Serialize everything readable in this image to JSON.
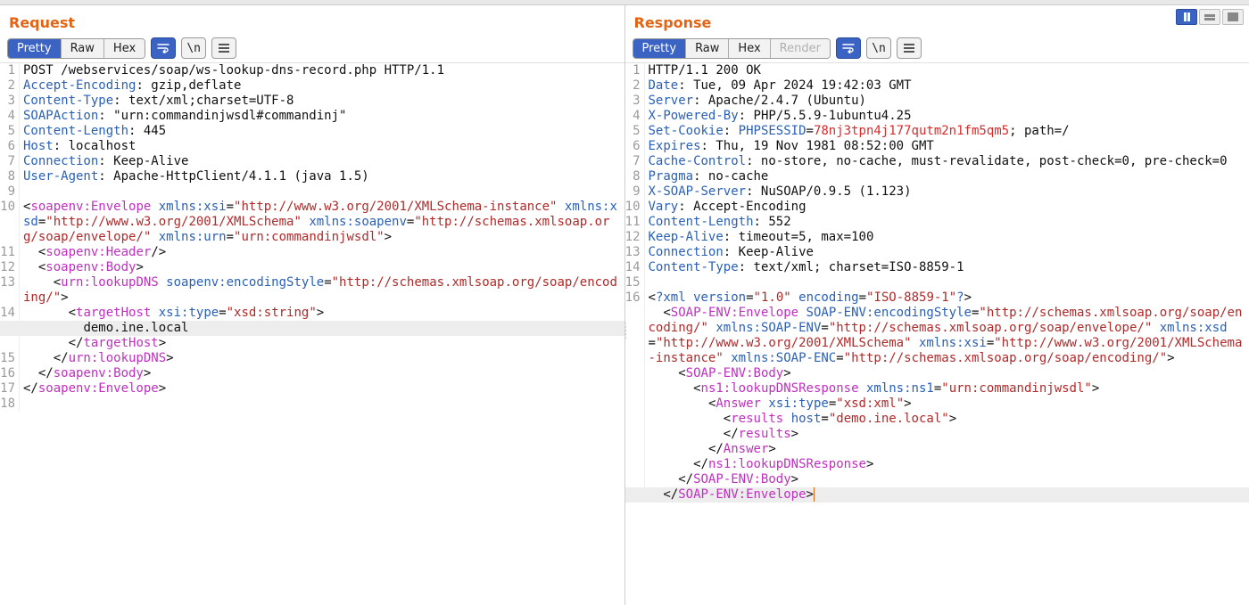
{
  "layout_buttons": [
    "split-vertical",
    "rows",
    "single"
  ],
  "layout_active": 0,
  "request": {
    "title": "Request",
    "tabs": [
      "Pretty",
      "Raw",
      "Hex"
    ],
    "activeTab": 0,
    "icons": [
      "wrap-icon",
      "newline-icon",
      "menu-icon"
    ],
    "lines": [
      {
        "n": 1,
        "raw": [
          [
            "txt",
            "POST /webservices/soap/ws-lookup-dns-record.php HTTP/1.1"
          ]
        ]
      },
      {
        "n": 2,
        "raw": [
          [
            "hdr",
            "Accept-Encoding"
          ],
          [
            "txt",
            ": gzip,deflate"
          ]
        ]
      },
      {
        "n": 3,
        "raw": [
          [
            "hdr",
            "Content-Type"
          ],
          [
            "txt",
            ": text/xml;charset=UTF-8"
          ]
        ]
      },
      {
        "n": 4,
        "raw": [
          [
            "hdr",
            "SOAPAction"
          ],
          [
            "txt",
            ": \"urn:commandinjwsdl#commandinj\""
          ]
        ]
      },
      {
        "n": 5,
        "raw": [
          [
            "hdr",
            "Content-Length"
          ],
          [
            "txt",
            ": 445"
          ]
        ]
      },
      {
        "n": 6,
        "raw": [
          [
            "hdr",
            "Host"
          ],
          [
            "txt",
            ": localhost"
          ]
        ]
      },
      {
        "n": 7,
        "raw": [
          [
            "hdr",
            "Connection"
          ],
          [
            "txt",
            ": Keep-Alive"
          ]
        ]
      },
      {
        "n": 8,
        "raw": [
          [
            "hdr",
            "User-Agent"
          ],
          [
            "txt",
            ": Apache-HttpClient/4.1.1 (java 1.5)"
          ]
        ]
      },
      {
        "n": 9,
        "raw": [
          [
            "txt",
            ""
          ]
        ]
      },
      {
        "n": 10,
        "raw": [
          [
            "txt",
            "<"
          ],
          [
            "tag",
            "soapenv:Envelope"
          ],
          [
            "txt",
            " "
          ],
          [
            "attr",
            "xmlns:xsi"
          ],
          [
            "txt",
            "="
          ],
          [
            "str",
            "\"http://www.w3.org/2001/XMLSchema-instance\""
          ],
          [
            "txt",
            " "
          ],
          [
            "attr",
            "xmlns:xsd"
          ],
          [
            "txt",
            "="
          ],
          [
            "str",
            "\"http://www.w3.org/2001/XMLSchema\""
          ],
          [
            "txt",
            " "
          ],
          [
            "attr",
            "xmlns:soapenv"
          ],
          [
            "txt",
            "="
          ],
          [
            "str",
            "\"http://schemas.xmlsoap.org/soap/envelope/\""
          ],
          [
            "txt",
            " "
          ],
          [
            "attr",
            "xmlns:urn"
          ],
          [
            "txt",
            "="
          ],
          [
            "str",
            "\"urn:commandinjwsdl\""
          ],
          [
            "txt",
            ">"
          ]
        ]
      },
      {
        "n": 11,
        "raw": [
          [
            "txt",
            "  <"
          ],
          [
            "tag",
            "soapenv:Header"
          ],
          [
            "txt",
            "/>"
          ]
        ]
      },
      {
        "n": 12,
        "raw": [
          [
            "txt",
            "  <"
          ],
          [
            "tag",
            "soapenv:Body"
          ],
          [
            "txt",
            ">"
          ]
        ]
      },
      {
        "n": 13,
        "raw": [
          [
            "txt",
            "    <"
          ],
          [
            "tag",
            "urn:lookupDNS"
          ],
          [
            "txt",
            " "
          ],
          [
            "attr",
            "soapenv:encodingStyle"
          ],
          [
            "txt",
            "="
          ],
          [
            "str",
            "\"http://schemas.xmlsoap.org/soap/encoding/\""
          ],
          [
            "txt",
            ">"
          ]
        ]
      },
      {
        "n": 14,
        "raw": [
          [
            "txt",
            "      <"
          ],
          [
            "tag",
            "targetHost"
          ],
          [
            "txt",
            " "
          ],
          [
            "attr",
            "xsi:type"
          ],
          [
            "txt",
            "="
          ],
          [
            "str",
            "\"xsd:string\""
          ],
          [
            "txt",
            ">"
          ]
        ]
      },
      {
        "n": "",
        "hl": true,
        "raw": [
          [
            "txt",
            "        demo.ine.local"
          ]
        ]
      },
      {
        "n": "",
        "raw": [
          [
            "txt",
            "      </"
          ],
          [
            "tag",
            "targetHost"
          ],
          [
            "txt",
            ">"
          ]
        ]
      },
      {
        "n": 15,
        "raw": [
          [
            "txt",
            "    </"
          ],
          [
            "tag",
            "urn:lookupDNS"
          ],
          [
            "txt",
            ">"
          ]
        ]
      },
      {
        "n": 16,
        "raw": [
          [
            "txt",
            "  </"
          ],
          [
            "tag",
            "soapenv:Body"
          ],
          [
            "txt",
            ">"
          ]
        ]
      },
      {
        "n": 17,
        "raw": [
          [
            "txt",
            "</"
          ],
          [
            "tag",
            "soapenv:Envelope"
          ],
          [
            "txt",
            ">"
          ]
        ]
      },
      {
        "n": 18,
        "raw": [
          [
            "txt",
            ""
          ]
        ]
      }
    ]
  },
  "response": {
    "title": "Response",
    "tabs": [
      "Pretty",
      "Raw",
      "Hex",
      "Render"
    ],
    "activeTab": 0,
    "disabledTabs": [
      3
    ],
    "icons": [
      "wrap-icon",
      "newline-icon",
      "menu-icon"
    ],
    "lines": [
      {
        "n": 1,
        "raw": [
          [
            "txt",
            "HTTP/1.1 200 OK"
          ]
        ]
      },
      {
        "n": 2,
        "raw": [
          [
            "hdr",
            "Date"
          ],
          [
            "txt",
            ": Tue, 09 Apr 2024 19:42:03 GMT"
          ]
        ]
      },
      {
        "n": 3,
        "raw": [
          [
            "hdr",
            "Server"
          ],
          [
            "txt",
            ": Apache/2.4.7 (Ubuntu)"
          ]
        ]
      },
      {
        "n": 4,
        "raw": [
          [
            "hdr",
            "X-Powered-By"
          ],
          [
            "txt",
            ": PHP/5.5.9-1ubuntu4.25"
          ]
        ]
      },
      {
        "n": 5,
        "raw": [
          [
            "hdr",
            "Set-Cookie"
          ],
          [
            "txt",
            ": "
          ],
          [
            "hdr",
            "PHPSESSID"
          ],
          [
            "txt",
            "="
          ],
          [
            "red",
            "78nj3tpn4j177qutm2n1fm5qm5"
          ],
          [
            "txt",
            "; path=/"
          ]
        ]
      },
      {
        "n": 6,
        "raw": [
          [
            "hdr",
            "Expires"
          ],
          [
            "txt",
            ": Thu, 19 Nov 1981 08:52:00 GMT"
          ]
        ]
      },
      {
        "n": 7,
        "raw": [
          [
            "hdr",
            "Cache-Control"
          ],
          [
            "txt",
            ": no-store, no-cache, must-revalidate, post-check=0, pre-check=0"
          ]
        ]
      },
      {
        "n": 8,
        "raw": [
          [
            "hdr",
            "Pragma"
          ],
          [
            "txt",
            ": no-cache"
          ]
        ]
      },
      {
        "n": 9,
        "raw": [
          [
            "hdr",
            "X-SOAP-Server"
          ],
          [
            "txt",
            ": NuSOAP/0.9.5 (1.123)"
          ]
        ]
      },
      {
        "n": 10,
        "raw": [
          [
            "hdr",
            "Vary"
          ],
          [
            "txt",
            ": Accept-Encoding"
          ]
        ]
      },
      {
        "n": 11,
        "raw": [
          [
            "hdr",
            "Content-Length"
          ],
          [
            "txt",
            ": 552"
          ]
        ]
      },
      {
        "n": 12,
        "raw": [
          [
            "hdr",
            "Keep-Alive"
          ],
          [
            "txt",
            ": timeout=5, max=100"
          ]
        ]
      },
      {
        "n": 13,
        "raw": [
          [
            "hdr",
            "Connection"
          ],
          [
            "txt",
            ": Keep-Alive"
          ]
        ]
      },
      {
        "n": 14,
        "raw": [
          [
            "hdr",
            "Content-Type"
          ],
          [
            "txt",
            ": text/xml; charset=ISO-8859-1"
          ]
        ]
      },
      {
        "n": 15,
        "raw": [
          [
            "txt",
            ""
          ]
        ]
      },
      {
        "n": 16,
        "raw": [
          [
            "txt",
            "<"
          ],
          [
            "pi",
            "?xml"
          ],
          [
            "txt",
            " "
          ],
          [
            "attr",
            "version"
          ],
          [
            "txt",
            "="
          ],
          [
            "str",
            "\"1.0\""
          ],
          [
            "txt",
            " "
          ],
          [
            "attr",
            "encoding"
          ],
          [
            "txt",
            "="
          ],
          [
            "str",
            "\"ISO-8859-1\""
          ],
          [
            "pi",
            "?"
          ],
          [
            "txt",
            ">"
          ]
        ]
      },
      {
        "n": "",
        "raw": [
          [
            "txt",
            "  <"
          ],
          [
            "tag",
            "SOAP-ENV:Envelope"
          ],
          [
            "txt",
            " "
          ],
          [
            "attr",
            "SOAP-ENV:encodingStyle"
          ],
          [
            "txt",
            "="
          ],
          [
            "str",
            "\"http://schemas.xmlsoap.org/soap/encoding/\""
          ],
          [
            "txt",
            " "
          ],
          [
            "attr",
            "xmlns:SOAP-ENV"
          ],
          [
            "txt",
            "="
          ],
          [
            "str",
            "\"http://schemas.xmlsoap.org/soap/envelope/\""
          ],
          [
            "txt",
            " "
          ],
          [
            "attr",
            "xmlns:xsd"
          ],
          [
            "txt",
            "="
          ],
          [
            "str",
            "\"http://www.w3.org/2001/XMLSchema\""
          ],
          [
            "txt",
            " "
          ],
          [
            "attr",
            "xmlns:xsi"
          ],
          [
            "txt",
            "="
          ],
          [
            "str",
            "\"http://www.w3.org/2001/XMLSchema-instance\""
          ],
          [
            "txt",
            " "
          ],
          [
            "attr",
            "xmlns:SOAP-ENC"
          ],
          [
            "txt",
            "="
          ],
          [
            "str",
            "\"http://schemas.xmlsoap.org/soap/encoding/\""
          ],
          [
            "txt",
            ">"
          ]
        ]
      },
      {
        "n": "",
        "raw": [
          [
            "txt",
            "    <"
          ],
          [
            "tag",
            "SOAP-ENV:Body"
          ],
          [
            "txt",
            ">"
          ]
        ]
      },
      {
        "n": "",
        "raw": [
          [
            "txt",
            "      <"
          ],
          [
            "tag",
            "ns1:lookupDNSResponse"
          ],
          [
            "txt",
            " "
          ],
          [
            "attr",
            "xmlns:ns1"
          ],
          [
            "txt",
            "="
          ],
          [
            "str",
            "\"urn:commandinjwsdl\""
          ],
          [
            "txt",
            ">"
          ]
        ]
      },
      {
        "n": "",
        "raw": [
          [
            "txt",
            "        <"
          ],
          [
            "tag",
            "Answer"
          ],
          [
            "txt",
            " "
          ],
          [
            "attr",
            "xsi:type"
          ],
          [
            "txt",
            "="
          ],
          [
            "str",
            "\"xsd:xml\""
          ],
          [
            "txt",
            ">"
          ]
        ]
      },
      {
        "n": "",
        "raw": [
          [
            "txt",
            "          <"
          ],
          [
            "tag",
            "results"
          ],
          [
            "txt",
            " "
          ],
          [
            "attr",
            "host"
          ],
          [
            "txt",
            "="
          ],
          [
            "str",
            "\"demo.ine.local\""
          ],
          [
            "txt",
            ">"
          ]
        ]
      },
      {
        "n": "",
        "raw": [
          [
            "txt",
            "          </"
          ],
          [
            "tag",
            "results"
          ],
          [
            "txt",
            ">"
          ]
        ]
      },
      {
        "n": "",
        "raw": [
          [
            "txt",
            "        </"
          ],
          [
            "tag",
            "Answer"
          ],
          [
            "txt",
            ">"
          ]
        ]
      },
      {
        "n": "",
        "raw": [
          [
            "txt",
            "      </"
          ],
          [
            "tag",
            "ns1:lookupDNSResponse"
          ],
          [
            "txt",
            ">"
          ]
        ]
      },
      {
        "n": "",
        "raw": [
          [
            "txt",
            "    </"
          ],
          [
            "tag",
            "SOAP-ENV:Body"
          ],
          [
            "txt",
            ">"
          ]
        ]
      },
      {
        "n": "",
        "hl": true,
        "cursor": true,
        "raw": [
          [
            "txt",
            "  </"
          ],
          [
            "tag",
            "SOAP-ENV:Envelope"
          ],
          [
            "txt",
            ">"
          ]
        ]
      }
    ]
  }
}
